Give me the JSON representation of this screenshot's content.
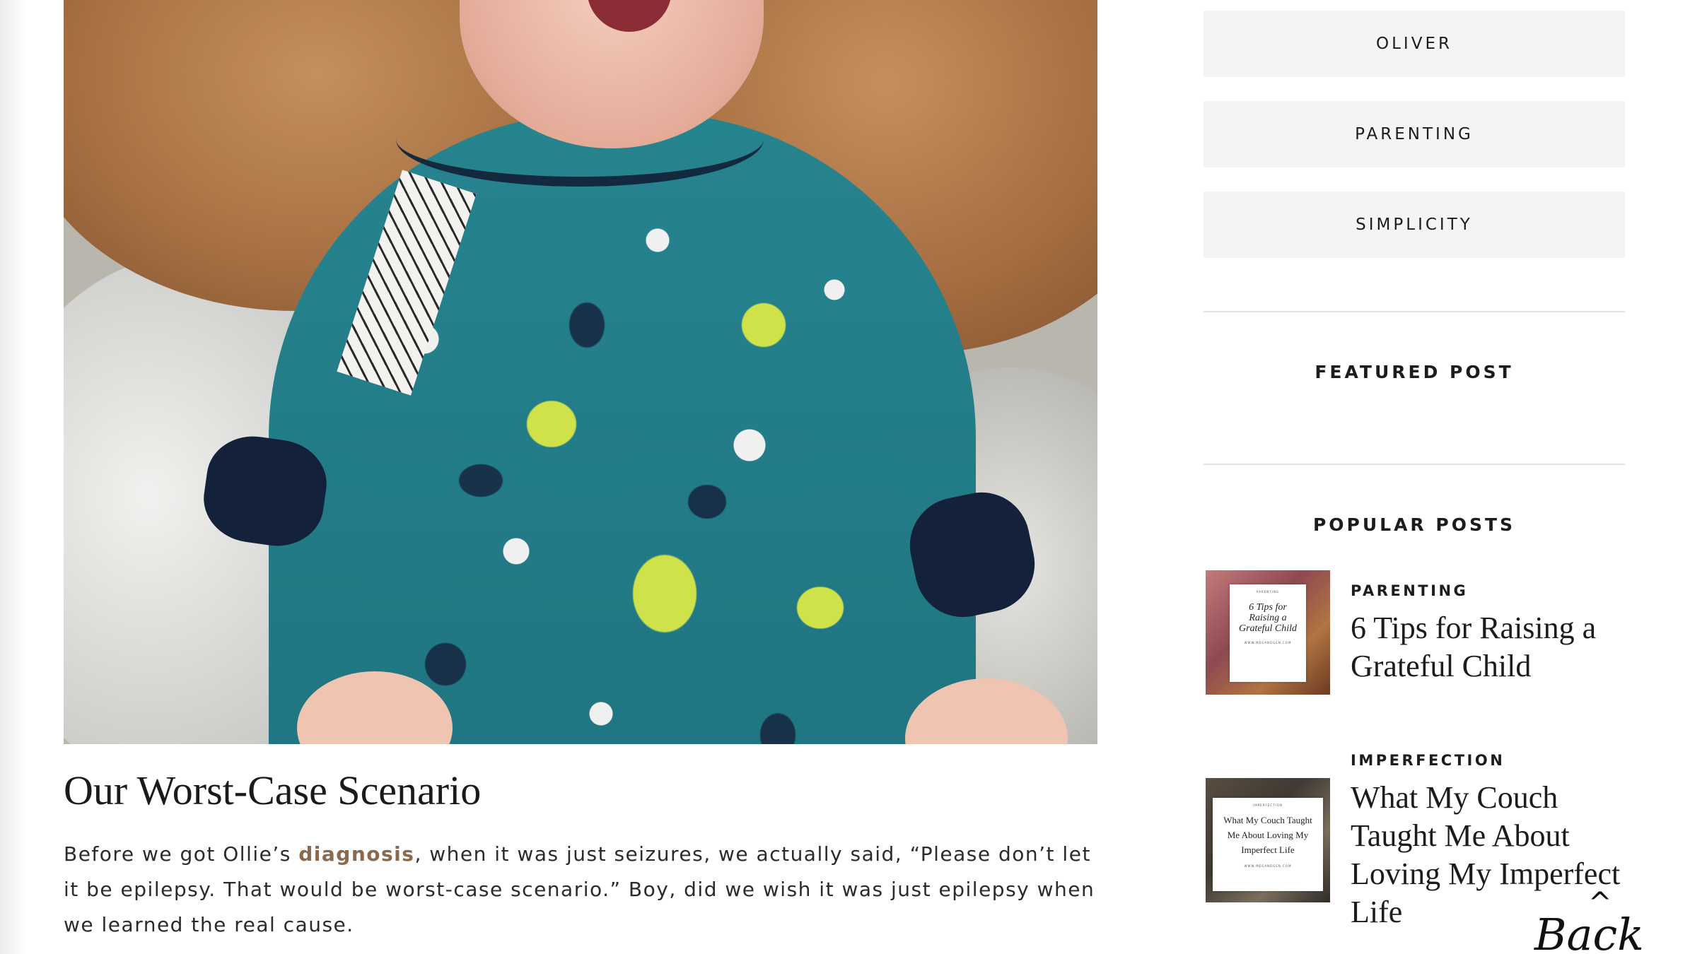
{
  "post": {
    "title": "Our Worst-Case Scenario",
    "body_before": "Before we got Ollie’s ",
    "body_link": "diagnosis",
    "body_after": ", when it was just seizures, we actually said, “Please don’t let it be epilepsy. That would be worst-case scenario.” Boy, did we wish it was just epilepsy when we learned the real cause."
  },
  "sidebar": {
    "categories": [
      "OLIVER",
      "PARENTING",
      "SIMPLICITY"
    ],
    "featured_title": "FEATURED POST",
    "popular_title": "POPULAR POSTS",
    "popular": [
      {
        "category": "PARENTING",
        "title": "6 Tips for Raising a Grateful Child",
        "thumb_small": "PARENTING",
        "thumb_text": "6 Tips for Raising a Grateful Child",
        "thumb_url": "WWW.MEGANDGEN.COM"
      },
      {
        "category": "IMPERFECTION",
        "title": "What My Couch Taught Me About Loving My Imperfect Life",
        "thumb_small": "IMPERFECTION",
        "thumb_text": "What My Couch Taught Me About Loving My Imperfect Life",
        "thumb_url": "WWW.MEGANDGEN.COM"
      }
    ]
  },
  "back_to_top": {
    "caret": "^",
    "label": "Back"
  },
  "colors": {
    "link": "#8a6a4e",
    "button_bg": "#f4f4f4",
    "text": "#1c1c1c"
  }
}
